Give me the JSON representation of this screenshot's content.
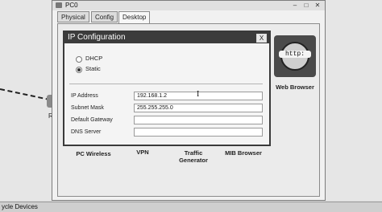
{
  "background": {
    "device_label": "Ro",
    "bottom_label": "ycle Devices"
  },
  "window": {
    "title": "PC0",
    "minimize": "–",
    "maximize": "□",
    "close": "✕",
    "tabs": [
      {
        "label": "Physical"
      },
      {
        "label": "Config"
      },
      {
        "label": "Desktop",
        "active": true
      }
    ]
  },
  "ip_config": {
    "title": "IP Configuration",
    "close": "X",
    "mode_dhcp": "DHCP",
    "mode_static": "Static",
    "selected_mode": "Static",
    "fields": {
      "ip_label": "IP Address",
      "ip_value": "192.168.1.2",
      "mask_label": "Subnet Mask",
      "mask_value": "255.255.255.0",
      "gateway_label": "Default Gateway",
      "gateway_value": "",
      "dns_label": "DNS Server",
      "dns_value": ""
    }
  },
  "apps": {
    "web_browser": "Web Browser",
    "web_icon_text": "http:",
    "pc_wireless": "PC Wireless",
    "vpn": "VPN",
    "traffic_generator": "Traffic\nGenerator",
    "mib_browser": "MIB Browser"
  },
  "cursor_glyph": "I"
}
